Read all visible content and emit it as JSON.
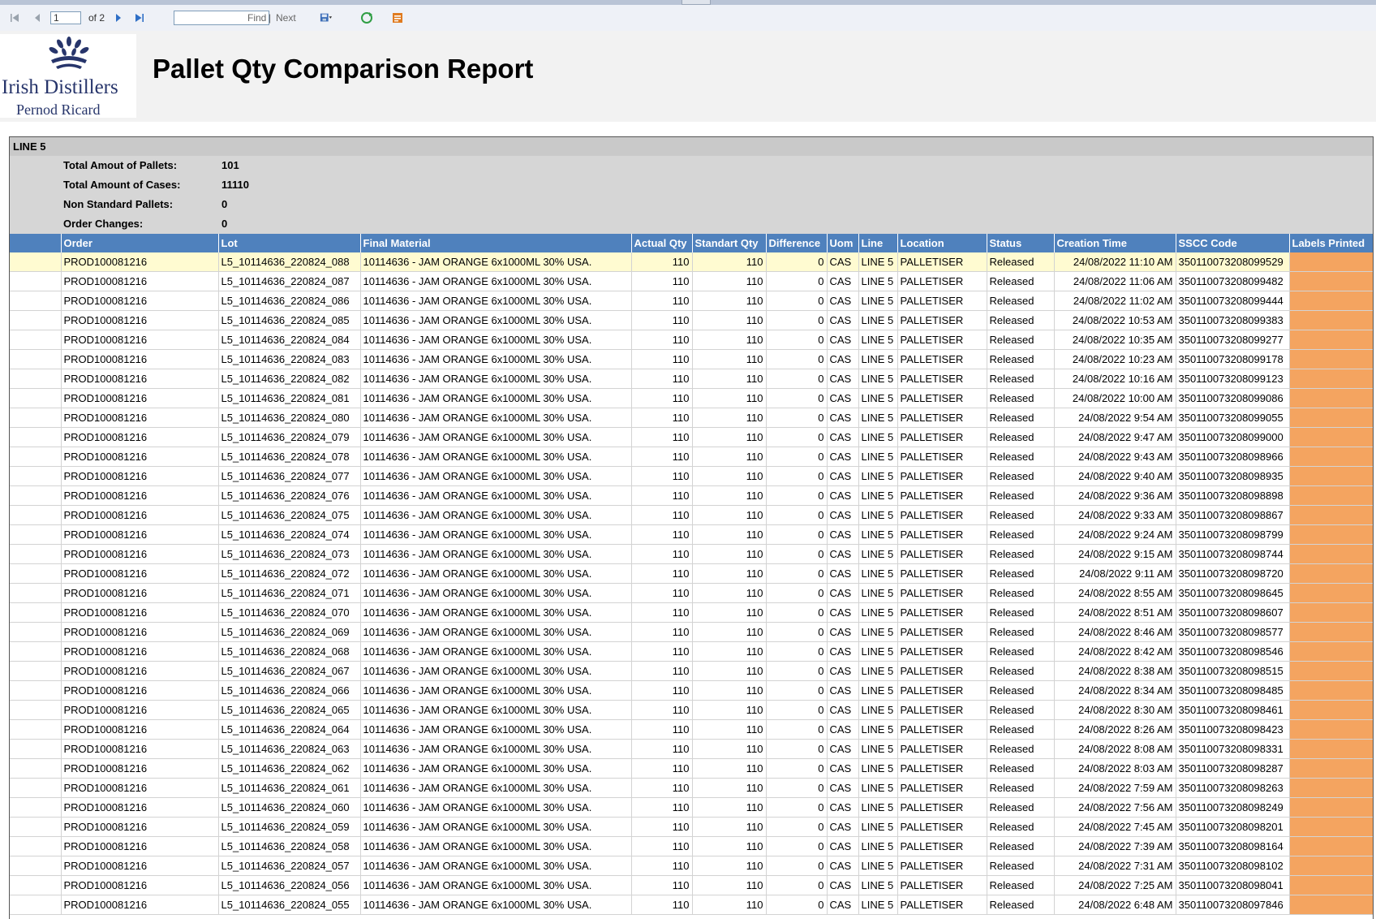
{
  "toolbar": {
    "page_value": "1",
    "of_pages": "of 2",
    "find_placeholder": "",
    "find_label": "Find",
    "separator": "|",
    "next_label": "Next"
  },
  "header": {
    "logo_line1": "Irish Distillers",
    "logo_line2": "Pernod Ricard",
    "title": "Pallet Qty Comparison Report"
  },
  "group": {
    "name": "LINE 5",
    "summary": [
      {
        "label": "Total Amout of Pallets:",
        "value": "101"
      },
      {
        "label": "Total Amount of Cases:",
        "value": "11110"
      },
      {
        "label": "Non Standard Pallets:",
        "value": "0"
      },
      {
        "label": "Order Changes:",
        "value": "0"
      }
    ]
  },
  "table": {
    "columns": [
      "",
      "Order",
      "Lot",
      "Final Material",
      "Actual Qty",
      "Standart Qty",
      "Difference",
      "Uom",
      "Line",
      "Location",
      "Status",
      "Creation Time",
      "SSCC Code",
      "Labels Printed"
    ],
    "rows": [
      [
        "",
        "PROD100081216",
        "L5_10114636_220824_088",
        "10114636 - JAM ORANGE 6x1000ML 30% USA.",
        "110",
        "110",
        "0",
        "CAS",
        "LINE 5",
        "PALLETISER",
        "Released",
        "24/08/2022 11:10 AM",
        "350110073208099529",
        ""
      ],
      [
        "",
        "PROD100081216",
        "L5_10114636_220824_087",
        "10114636 - JAM ORANGE 6x1000ML 30% USA.",
        "110",
        "110",
        "0",
        "CAS",
        "LINE 5",
        "PALLETISER",
        "Released",
        "24/08/2022 11:06 AM",
        "350110073208099482",
        ""
      ],
      [
        "",
        "PROD100081216",
        "L5_10114636_220824_086",
        "10114636 - JAM ORANGE 6x1000ML 30% USA.",
        "110",
        "110",
        "0",
        "CAS",
        "LINE 5",
        "PALLETISER",
        "Released",
        "24/08/2022 11:02 AM",
        "350110073208099444",
        ""
      ],
      [
        "",
        "PROD100081216",
        "L5_10114636_220824_085",
        "10114636 - JAM ORANGE 6x1000ML 30% USA.",
        "110",
        "110",
        "0",
        "CAS",
        "LINE 5",
        "PALLETISER",
        "Released",
        "24/08/2022 10:53 AM",
        "350110073208099383",
        ""
      ],
      [
        "",
        "PROD100081216",
        "L5_10114636_220824_084",
        "10114636 - JAM ORANGE 6x1000ML 30% USA.",
        "110",
        "110",
        "0",
        "CAS",
        "LINE 5",
        "PALLETISER",
        "Released",
        "24/08/2022 10:35 AM",
        "350110073208099277",
        ""
      ],
      [
        "",
        "PROD100081216",
        "L5_10114636_220824_083",
        "10114636 - JAM ORANGE 6x1000ML 30% USA.",
        "110",
        "110",
        "0",
        "CAS",
        "LINE 5",
        "PALLETISER",
        "Released",
        "24/08/2022 10:23 AM",
        "350110073208099178",
        ""
      ],
      [
        "",
        "PROD100081216",
        "L5_10114636_220824_082",
        "10114636 - JAM ORANGE 6x1000ML 30% USA.",
        "110",
        "110",
        "0",
        "CAS",
        "LINE 5",
        "PALLETISER",
        "Released",
        "24/08/2022 10:16 AM",
        "350110073208099123",
        ""
      ],
      [
        "",
        "PROD100081216",
        "L5_10114636_220824_081",
        "10114636 - JAM ORANGE 6x1000ML 30% USA.",
        "110",
        "110",
        "0",
        "CAS",
        "LINE 5",
        "PALLETISER",
        "Released",
        "24/08/2022 10:00 AM",
        "350110073208099086",
        ""
      ],
      [
        "",
        "PROD100081216",
        "L5_10114636_220824_080",
        "10114636 - JAM ORANGE 6x1000ML 30% USA.",
        "110",
        "110",
        "0",
        "CAS",
        "LINE 5",
        "PALLETISER",
        "Released",
        "24/08/2022 9:54 AM",
        "350110073208099055",
        ""
      ],
      [
        "",
        "PROD100081216",
        "L5_10114636_220824_079",
        "10114636 - JAM ORANGE 6x1000ML 30% USA.",
        "110",
        "110",
        "0",
        "CAS",
        "LINE 5",
        "PALLETISER",
        "Released",
        "24/08/2022 9:47 AM",
        "350110073208099000",
        ""
      ],
      [
        "",
        "PROD100081216",
        "L5_10114636_220824_078",
        "10114636 - JAM ORANGE 6x1000ML 30% USA.",
        "110",
        "110",
        "0",
        "CAS",
        "LINE 5",
        "PALLETISER",
        "Released",
        "24/08/2022 9:43 AM",
        "350110073208098966",
        ""
      ],
      [
        "",
        "PROD100081216",
        "L5_10114636_220824_077",
        "10114636 - JAM ORANGE 6x1000ML 30% USA.",
        "110",
        "110",
        "0",
        "CAS",
        "LINE 5",
        "PALLETISER",
        "Released",
        "24/08/2022 9:40 AM",
        "350110073208098935",
        ""
      ],
      [
        "",
        "PROD100081216",
        "L5_10114636_220824_076",
        "10114636 - JAM ORANGE 6x1000ML 30% USA.",
        "110",
        "110",
        "0",
        "CAS",
        "LINE 5",
        "PALLETISER",
        "Released",
        "24/08/2022 9:36 AM",
        "350110073208098898",
        ""
      ],
      [
        "",
        "PROD100081216",
        "L5_10114636_220824_075",
        "10114636 - JAM ORANGE 6x1000ML 30% USA.",
        "110",
        "110",
        "0",
        "CAS",
        "LINE 5",
        "PALLETISER",
        "Released",
        "24/08/2022 9:33 AM",
        "350110073208098867",
        ""
      ],
      [
        "",
        "PROD100081216",
        "L5_10114636_220824_074",
        "10114636 - JAM ORANGE 6x1000ML 30% USA.",
        "110",
        "110",
        "0",
        "CAS",
        "LINE 5",
        "PALLETISER",
        "Released",
        "24/08/2022 9:24 AM",
        "350110073208098799",
        ""
      ],
      [
        "",
        "PROD100081216",
        "L5_10114636_220824_073",
        "10114636 - JAM ORANGE 6x1000ML 30% USA.",
        "110",
        "110",
        "0",
        "CAS",
        "LINE 5",
        "PALLETISER",
        "Released",
        "24/08/2022 9:15 AM",
        "350110073208098744",
        ""
      ],
      [
        "",
        "PROD100081216",
        "L5_10114636_220824_072",
        "10114636 - JAM ORANGE 6x1000ML 30% USA.",
        "110",
        "110",
        "0",
        "CAS",
        "LINE 5",
        "PALLETISER",
        "Released",
        "24/08/2022 9:11 AM",
        "350110073208098720",
        ""
      ],
      [
        "",
        "PROD100081216",
        "L5_10114636_220824_071",
        "10114636 - JAM ORANGE 6x1000ML 30% USA.",
        "110",
        "110",
        "0",
        "CAS",
        "LINE 5",
        "PALLETISER",
        "Released",
        "24/08/2022 8:55 AM",
        "350110073208098645",
        ""
      ],
      [
        "",
        "PROD100081216",
        "L5_10114636_220824_070",
        "10114636 - JAM ORANGE 6x1000ML 30% USA.",
        "110",
        "110",
        "0",
        "CAS",
        "LINE 5",
        "PALLETISER",
        "Released",
        "24/08/2022 8:51 AM",
        "350110073208098607",
        ""
      ],
      [
        "",
        "PROD100081216",
        "L5_10114636_220824_069",
        "10114636 - JAM ORANGE 6x1000ML 30% USA.",
        "110",
        "110",
        "0",
        "CAS",
        "LINE 5",
        "PALLETISER",
        "Released",
        "24/08/2022 8:46 AM",
        "350110073208098577",
        ""
      ],
      [
        "",
        "PROD100081216",
        "L5_10114636_220824_068",
        "10114636 - JAM ORANGE 6x1000ML 30% USA.",
        "110",
        "110",
        "0",
        "CAS",
        "LINE 5",
        "PALLETISER",
        "Released",
        "24/08/2022 8:42 AM",
        "350110073208098546",
        ""
      ],
      [
        "",
        "PROD100081216",
        "L5_10114636_220824_067",
        "10114636 - JAM ORANGE 6x1000ML 30% USA.",
        "110",
        "110",
        "0",
        "CAS",
        "LINE 5",
        "PALLETISER",
        "Released",
        "24/08/2022 8:38 AM",
        "350110073208098515",
        ""
      ],
      [
        "",
        "PROD100081216",
        "L5_10114636_220824_066",
        "10114636 - JAM ORANGE 6x1000ML 30% USA.",
        "110",
        "110",
        "0",
        "CAS",
        "LINE 5",
        "PALLETISER",
        "Released",
        "24/08/2022 8:34 AM",
        "350110073208098485",
        ""
      ],
      [
        "",
        "PROD100081216",
        "L5_10114636_220824_065",
        "10114636 - JAM ORANGE 6x1000ML 30% USA.",
        "110",
        "110",
        "0",
        "CAS",
        "LINE 5",
        "PALLETISER",
        "Released",
        "24/08/2022 8:30 AM",
        "350110073208098461",
        ""
      ],
      [
        "",
        "PROD100081216",
        "L5_10114636_220824_064",
        "10114636 - JAM ORANGE 6x1000ML 30% USA.",
        "110",
        "110",
        "0",
        "CAS",
        "LINE 5",
        "PALLETISER",
        "Released",
        "24/08/2022 8:26 AM",
        "350110073208098423",
        ""
      ],
      [
        "",
        "PROD100081216",
        "L5_10114636_220824_063",
        "10114636 - JAM ORANGE 6x1000ML 30% USA.",
        "110",
        "110",
        "0",
        "CAS",
        "LINE 5",
        "PALLETISER",
        "Released",
        "24/08/2022 8:08 AM",
        "350110073208098331",
        ""
      ],
      [
        "",
        "PROD100081216",
        "L5_10114636_220824_062",
        "10114636 - JAM ORANGE 6x1000ML 30% USA.",
        "110",
        "110",
        "0",
        "CAS",
        "LINE 5",
        "PALLETISER",
        "Released",
        "24/08/2022 8:03 AM",
        "350110073208098287",
        ""
      ],
      [
        "",
        "PROD100081216",
        "L5_10114636_220824_061",
        "10114636 - JAM ORANGE 6x1000ML 30% USA.",
        "110",
        "110",
        "0",
        "CAS",
        "LINE 5",
        "PALLETISER",
        "Released",
        "24/08/2022 7:59 AM",
        "350110073208098263",
        ""
      ],
      [
        "",
        "PROD100081216",
        "L5_10114636_220824_060",
        "10114636 - JAM ORANGE 6x1000ML 30% USA.",
        "110",
        "110",
        "0",
        "CAS",
        "LINE 5",
        "PALLETISER",
        "Released",
        "24/08/2022 7:56 AM",
        "350110073208098249",
        ""
      ],
      [
        "",
        "PROD100081216",
        "L5_10114636_220824_059",
        "10114636 - JAM ORANGE 6x1000ML 30% USA.",
        "110",
        "110",
        "0",
        "CAS",
        "LINE 5",
        "PALLETISER",
        "Released",
        "24/08/2022 7:45 AM",
        "350110073208098201",
        ""
      ],
      [
        "",
        "PROD100081216",
        "L5_10114636_220824_058",
        "10114636 - JAM ORANGE 6x1000ML 30% USA.",
        "110",
        "110",
        "0",
        "CAS",
        "LINE 5",
        "PALLETISER",
        "Released",
        "24/08/2022 7:39 AM",
        "350110073208098164",
        ""
      ],
      [
        "",
        "PROD100081216",
        "L5_10114636_220824_057",
        "10114636 - JAM ORANGE 6x1000ML 30% USA.",
        "110",
        "110",
        "0",
        "CAS",
        "LINE 5",
        "PALLETISER",
        "Released",
        "24/08/2022 7:31 AM",
        "350110073208098102",
        ""
      ],
      [
        "",
        "PROD100081216",
        "L5_10114636_220824_056",
        "10114636 - JAM ORANGE 6x1000ML 30% USA.",
        "110",
        "110",
        "0",
        "CAS",
        "LINE 5",
        "PALLETISER",
        "Released",
        "24/08/2022 7:25 AM",
        "350110073208098041",
        ""
      ],
      [
        "",
        "PROD100081216",
        "L5_10114636_220824_055",
        "10114636 - JAM ORANGE 6x1000ML 30% USA.",
        "110",
        "110",
        "0",
        "CAS",
        "LINE 5",
        "PALLETISER",
        "Released",
        "24/08/2022 6:48 AM",
        "350110073208097846",
        ""
      ]
    ]
  },
  "colors": {
    "header_blue": "#4f81bd",
    "labels_printed_fill": "#f4a460",
    "selected_row": "#fffbd1",
    "summary_grey": "#d6d6d6"
  },
  "icons": [
    "first-page-icon",
    "previous-page-icon",
    "next-page-icon",
    "last-page-icon",
    "export-icon",
    "refresh-icon",
    "print-icon"
  ]
}
